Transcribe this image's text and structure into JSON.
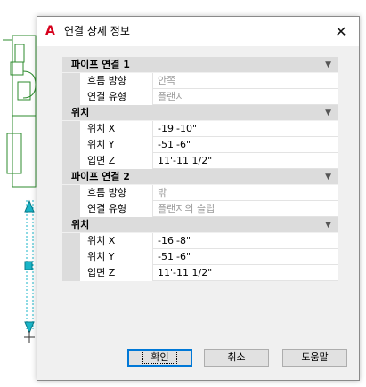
{
  "window": {
    "title": "연결 상세 정보",
    "app_icon_glyph": "A",
    "close_glyph": "✕"
  },
  "sections": [
    {
      "header": "파이프 연결 1",
      "rows": [
        {
          "label": "흐름 방향",
          "value": "안쪽"
        },
        {
          "label": "연결 유형",
          "value": "플랜지"
        }
      ],
      "position": {
        "header": "위치",
        "rows": [
          {
            "label": "위치 X",
            "value": "-19'-10\""
          },
          {
            "label": "위치 Y",
            "value": "-51'-6\""
          },
          {
            "label": "입면 Z",
            "value": "11'-11 1/2\""
          }
        ]
      }
    },
    {
      "header": "파이프 연결 2",
      "rows": [
        {
          "label": "흐름 방향",
          "value": "밖"
        },
        {
          "label": "연결 유형",
          "value": "플랜지의 슬립"
        }
      ],
      "position": {
        "header": "위치",
        "rows": [
          {
            "label": "위치 X",
            "value": "-16'-8\""
          },
          {
            "label": "위치 Y",
            "value": "-51'-6\""
          },
          {
            "label": "입면 Z",
            "value": "11'-11 1/2\""
          }
        ]
      }
    }
  ],
  "buttons": {
    "ok": "확인",
    "cancel": "취소",
    "help": "도움말"
  },
  "colors": {
    "accent": "#0078d7",
    "brand": "#d6001c",
    "cad_green": "#2e8b2e",
    "cad_cyan": "#19b5c8"
  }
}
